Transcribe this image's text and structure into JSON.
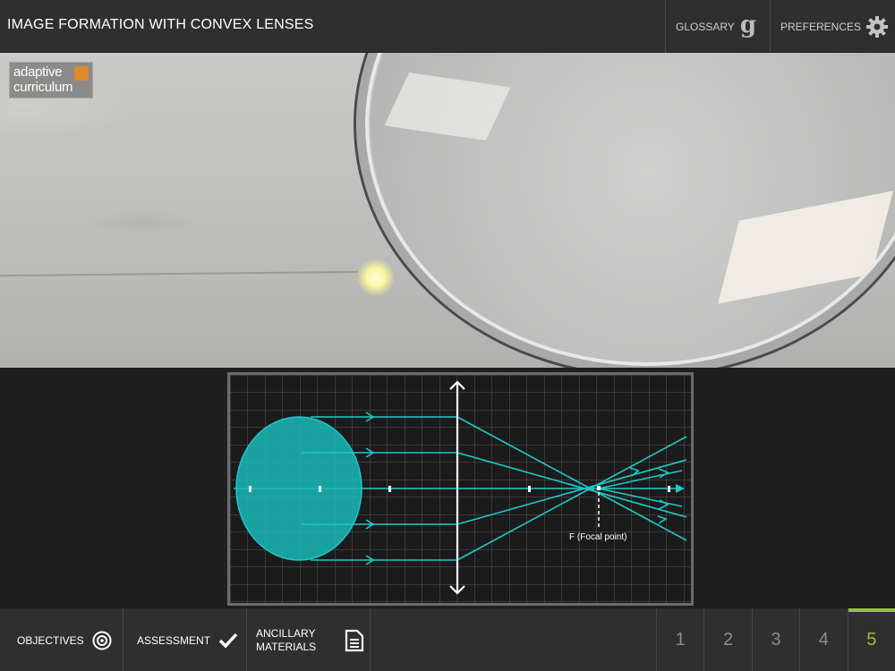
{
  "header": {
    "title": "IMAGE FORMATION WITH CONVEX LENSES",
    "glossary_label": "GLOSSARY",
    "glossary_glyph": "g",
    "preferences_label": "PREFERENCES"
  },
  "logo": {
    "line1": "adaptive",
    "line2": "curriculum"
  },
  "diagram": {
    "focal_label": "F (Focal point)",
    "accent_color": "#1fc9c9",
    "object_color": "#19b9b7"
  },
  "footer": {
    "objectives_label": "OBJECTIVES",
    "assessment_label": "ASSESSMENT",
    "ancillary_label": "ANCILLARY MATERIALS",
    "pages": [
      "1",
      "2",
      "3",
      "4",
      "5"
    ],
    "active_page": "5",
    "active_color": "#9bbf3a"
  }
}
